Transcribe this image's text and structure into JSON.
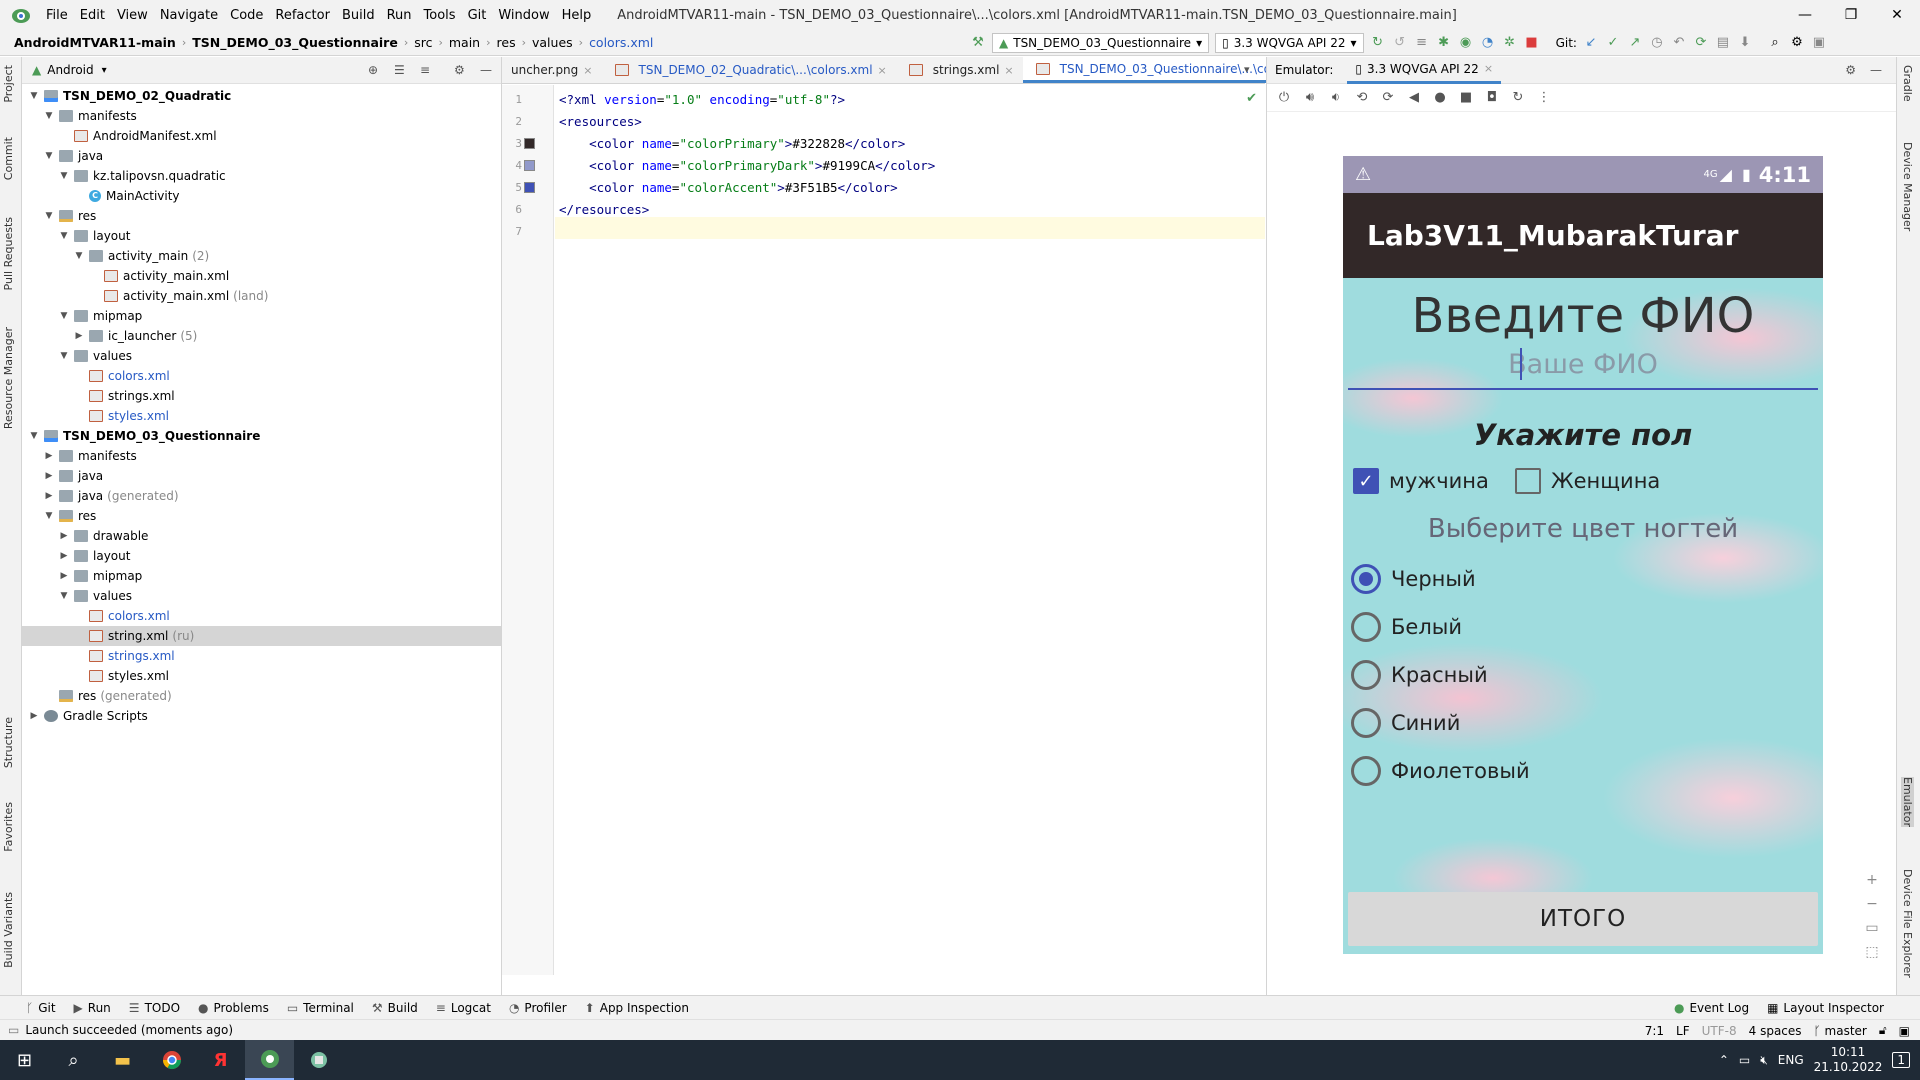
{
  "menubar": {
    "items": [
      "File",
      "Edit",
      "View",
      "Navigate",
      "Code",
      "Refactor",
      "Build",
      "Run",
      "Tools",
      "Git",
      "Window",
      "Help"
    ],
    "title": "AndroidMTVAR11-main - TSN_DEMO_03_Questionnaire\\...\\colors.xml [AndroidMTVAR11-main.TSN_DEMO_03_Questionnaire.main]"
  },
  "breadcrumb": [
    "AndroidMTVAR11-main",
    "TSN_DEMO_03_Questionnaire",
    "src",
    "main",
    "res",
    "values",
    "colors.xml"
  ],
  "toolbar": {
    "run_config": "TSN_DEMO_03_Questionnaire",
    "device": "3.3  WQVGA API 22",
    "git_label": "Git:"
  },
  "left_tabs": [
    "Project",
    "Commit",
    "Pull Requests",
    "Resource Manager",
    "Structure",
    "Favorites",
    "Build Variants"
  ],
  "project": {
    "view_mode": "Android",
    "tree": [
      {
        "level": 0,
        "arrow": "down",
        "icon": "mod",
        "label": "TSN_DEMO_02_Quadratic",
        "bold": true
      },
      {
        "level": 1,
        "arrow": "down",
        "icon": "fold",
        "label": "manifests"
      },
      {
        "level": 2,
        "arrow": "",
        "icon": "xml",
        "label": "AndroidManifest.xml"
      },
      {
        "level": 1,
        "arrow": "down",
        "icon": "fold",
        "label": "java"
      },
      {
        "level": 2,
        "arrow": "down",
        "icon": "fold",
        "label": "kz.talipovsn.quadratic"
      },
      {
        "level": 3,
        "arrow": "",
        "icon": "class",
        "label": "MainActivity"
      },
      {
        "level": 1,
        "arrow": "down",
        "icon": "fold-res",
        "label": "res"
      },
      {
        "level": 2,
        "arrow": "down",
        "icon": "fold",
        "label": "layout"
      },
      {
        "level": 3,
        "arrow": "down",
        "icon": "fold",
        "label": "activity_main",
        "suffix": "(2)"
      },
      {
        "level": 4,
        "arrow": "",
        "icon": "xml",
        "label": "activity_main.xml"
      },
      {
        "level": 4,
        "arrow": "",
        "icon": "xml",
        "label": "activity_main.xml",
        "suffix": "(land)"
      },
      {
        "level": 2,
        "arrow": "down",
        "icon": "fold",
        "label": "mipmap"
      },
      {
        "level": 3,
        "arrow": "right",
        "icon": "fold",
        "label": "ic_launcher",
        "suffix": "(5)"
      },
      {
        "level": 2,
        "arrow": "down",
        "icon": "fold",
        "label": "values"
      },
      {
        "level": 3,
        "arrow": "",
        "icon": "xml",
        "label": "colors.xml",
        "blue": true
      },
      {
        "level": 3,
        "arrow": "",
        "icon": "xml",
        "label": "strings.xml"
      },
      {
        "level": 3,
        "arrow": "",
        "icon": "xml",
        "label": "styles.xml",
        "blue": true
      },
      {
        "level": 0,
        "arrow": "down",
        "icon": "mod",
        "label": "TSN_DEMO_03_Questionnaire",
        "bold": true
      },
      {
        "level": 1,
        "arrow": "right",
        "icon": "fold",
        "label": "manifests"
      },
      {
        "level": 1,
        "arrow": "right",
        "icon": "fold",
        "label": "java"
      },
      {
        "level": 1,
        "arrow": "right",
        "icon": "fold",
        "label": "java",
        "suffix": "(generated)"
      },
      {
        "level": 1,
        "arrow": "down",
        "icon": "fold-res",
        "label": "res"
      },
      {
        "level": 2,
        "arrow": "right",
        "icon": "fold",
        "label": "drawable"
      },
      {
        "level": 2,
        "arrow": "right",
        "icon": "fold",
        "label": "layout"
      },
      {
        "level": 2,
        "arrow": "right",
        "icon": "fold",
        "label": "mipmap"
      },
      {
        "level": 2,
        "arrow": "down",
        "icon": "fold",
        "label": "values"
      },
      {
        "level": 3,
        "arrow": "",
        "icon": "xml",
        "label": "colors.xml",
        "blue": true
      },
      {
        "level": 3,
        "arrow": "",
        "icon": "xml",
        "label": "string.xml",
        "suffix": "(ru)",
        "selected": true
      },
      {
        "level": 3,
        "arrow": "",
        "icon": "xml",
        "label": "strings.xml",
        "blue": true
      },
      {
        "level": 3,
        "arrow": "",
        "icon": "xml",
        "label": "styles.xml"
      },
      {
        "level": 1,
        "arrow": "",
        "icon": "fold-res",
        "label": "res",
        "suffix": "(generated)"
      },
      {
        "level": 0,
        "arrow": "right",
        "icon": "gradle",
        "label": "Gradle Scripts"
      }
    ]
  },
  "editor": {
    "tabs": [
      {
        "label": "uncher.png",
        "close": "×"
      },
      {
        "label": "TSN_DEMO_02_Quadratic\\...\\colors.xml",
        "close": "×"
      },
      {
        "label": "strings.xml",
        "close": "×"
      },
      {
        "label": "TSN_DEMO_03_Questionnaire\\...\\colors.xml",
        "close": "×",
        "active": true
      }
    ],
    "lines": [
      {
        "n": "1",
        "parts": [
          [
            "tg",
            "<?xml "
          ],
          [
            "at",
            "version"
          ],
          [
            "tx",
            "="
          ],
          [
            "vl",
            "\"1.0\""
          ],
          [
            "tx",
            " "
          ],
          [
            "at",
            "encoding"
          ],
          [
            "tx",
            "="
          ],
          [
            "vl",
            "\"utf-8\""
          ],
          [
            "tg",
            "?>"
          ]
        ]
      },
      {
        "n": "2",
        "parts": [
          [
            "tg",
            "<resources>"
          ]
        ]
      },
      {
        "n": "3",
        "swatch": "#322828",
        "parts": [
          [
            "tx",
            "    "
          ],
          [
            "tg",
            "<color "
          ],
          [
            "at",
            "name"
          ],
          [
            "tx",
            "="
          ],
          [
            "vl",
            "\"colorPrimary\""
          ],
          [
            "tg",
            ">"
          ],
          [
            "tx",
            "#322828"
          ],
          [
            "tg",
            "</color>"
          ]
        ]
      },
      {
        "n": "4",
        "swatch": "#9199CA",
        "parts": [
          [
            "tx",
            "    "
          ],
          [
            "tg",
            "<color "
          ],
          [
            "at",
            "name"
          ],
          [
            "tx",
            "="
          ],
          [
            "vl",
            "\"colorPrimaryDark\""
          ],
          [
            "tg",
            ">"
          ],
          [
            "tx",
            "#9199CA"
          ],
          [
            "tg",
            "</color>"
          ]
        ]
      },
      {
        "n": "5",
        "swatch": "#3F51B5",
        "parts": [
          [
            "tx",
            "    "
          ],
          [
            "tg",
            "<color "
          ],
          [
            "at",
            "name"
          ],
          [
            "tx",
            "="
          ],
          [
            "vl",
            "\"colorAccent\""
          ],
          [
            "tg",
            ">"
          ],
          [
            "tx",
            "#3F51B5"
          ],
          [
            "tg",
            "</color>"
          ]
        ]
      },
      {
        "n": "6",
        "parts": [
          [
            "tg",
            "</resources>"
          ]
        ]
      },
      {
        "n": "7",
        "parts": []
      }
    ]
  },
  "emulator": {
    "label": "Emulator:",
    "device_tab": "3.3  WQVGA API 22",
    "phone": {
      "status_time": "4:11",
      "network": "4G",
      "app_title": "Lab3V11_MubarakTurar",
      "heading": "Введите ФИО",
      "input_placeholder": "Ваше ФИО",
      "gender_heading": "Укажите пол",
      "gender_options": [
        {
          "label": "мужчина",
          "checked": true
        },
        {
          "label": "Женщина",
          "checked": false
        }
      ],
      "color_hint": "Выберите цвет ногтей",
      "color_options": [
        {
          "label": "Черный",
          "selected": true
        },
        {
          "label": "Белый",
          "selected": false
        },
        {
          "label": "Красный",
          "selected": false
        },
        {
          "label": "Синий",
          "selected": false
        },
        {
          "label": "Фиолетовый",
          "selected": false
        }
      ],
      "button_label": "ИТОГО"
    }
  },
  "right_tabs": [
    "Gradle",
    "Device Manager",
    "Emulator",
    "Device File Explorer"
  ],
  "tool_windows": [
    "Git",
    "Run",
    "TODO",
    "Problems",
    "Terminal",
    "Build",
    "Logcat",
    "Profiler",
    "App Inspection"
  ],
  "tool_windows_right": [
    "Event Log",
    "Layout Inspector"
  ],
  "status": {
    "message": "Launch succeeded (moments ago)",
    "position": "7:1",
    "line_sep": "LF",
    "encoding": "UTF-8",
    "indent": "4 spaces",
    "branch": "master"
  },
  "taskbar": {
    "lang": "ENG",
    "time": "10:11",
    "date": "21.10.2022",
    "notifications": "1"
  }
}
